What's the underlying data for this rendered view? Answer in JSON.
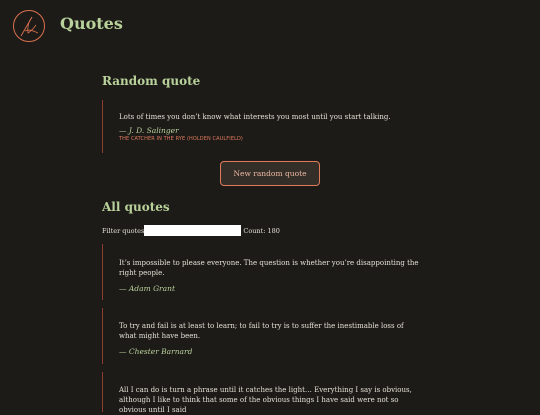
{
  "header": {
    "title": "Quotes",
    "logo_icon": "feather-quill-icon"
  },
  "random": {
    "heading": "Random quote",
    "quote": {
      "text": "Lots of times you don’t know what interests you most until you start talking.",
      "author": "— J. D. Salinger",
      "source": "THE CATCHER IN THE RYE (HOLDEN CAULFIELD)"
    },
    "button_label": "New random quote"
  },
  "all": {
    "heading": "All quotes",
    "filter_label": "Filter quotes",
    "filter_value": "",
    "count_label": "Count: 180",
    "quotes": [
      {
        "text": "It’s impossible to please everyone. The question is whether you’re disappointing the right people.",
        "author": "— Adam Grant"
      },
      {
        "text": "To try and fail is at least to learn; to fail to try is to suffer the inestimable loss of what might have been.",
        "author": "— Chester Barnard"
      },
      {
        "text": "All I can do is turn a phrase until it catches the light… Everything I say is obvious, although I like to think that some of the obvious things I have said were not so obvious until I said",
        "author": ""
      }
    ]
  },
  "colors": {
    "background": "#1d1b18",
    "heading": "#b9d29b",
    "accent": "#e07a5a",
    "border": "#8a3e2e",
    "text": "#e4e0d6"
  }
}
